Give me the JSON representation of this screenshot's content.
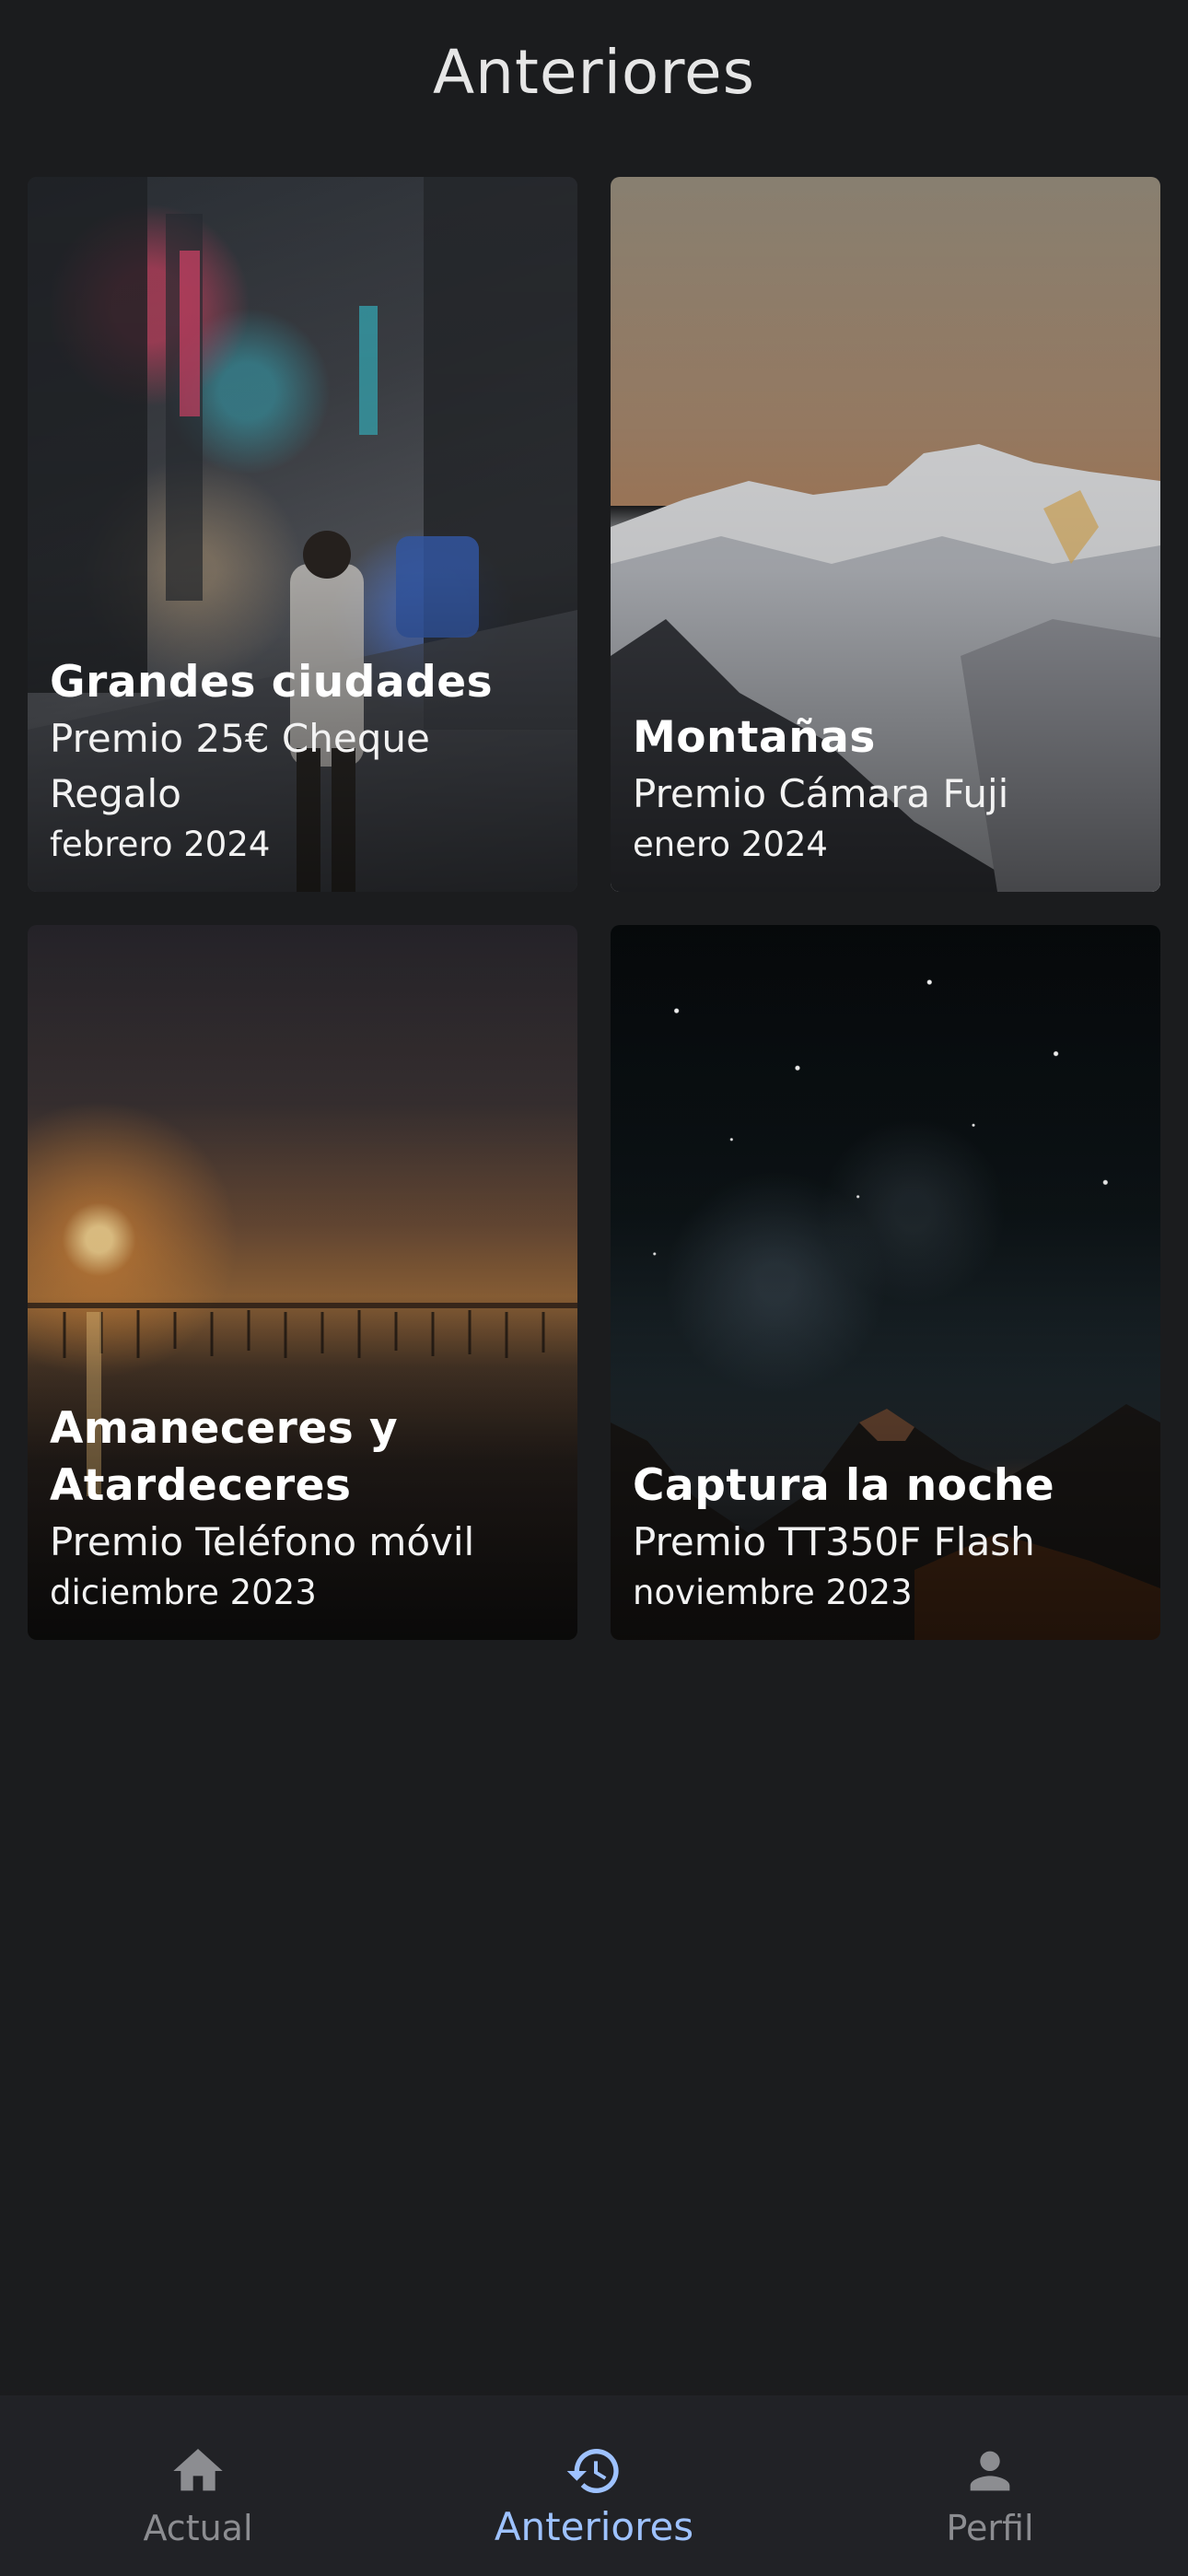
{
  "header": {
    "title": "Anteriores"
  },
  "cards": [
    {
      "title": "Grandes ciudades",
      "prize": "Premio 25€ Cheque Regalo",
      "date": "febrero 2024",
      "photo": "city-night-street"
    },
    {
      "title": "Montañas",
      "prize": "Premio Cámara Fuji",
      "date": "enero 2024",
      "photo": "snowy-mountains"
    },
    {
      "title": "Amaneceres y Atardeceres",
      "prize": "Premio Teléfono móvil",
      "date": "diciembre 2023",
      "photo": "sunset-lake"
    },
    {
      "title": "Captura la noche",
      "prize": "Premio TT350F Flash",
      "date": "noviembre 2023",
      "photo": "starry-mountains"
    }
  ],
  "bottom_nav": {
    "items": [
      {
        "label": "Actual",
        "icon": "home-icon",
        "active": false
      },
      {
        "label": "Anteriores",
        "icon": "history-icon",
        "active": true
      },
      {
        "label": "Perfil",
        "icon": "person-icon",
        "active": false
      }
    ]
  },
  "colors": {
    "background": "#1b1c1e",
    "nav_background": "#212226",
    "accent": "#9ec2ff",
    "inactive": "#8c8d91"
  }
}
